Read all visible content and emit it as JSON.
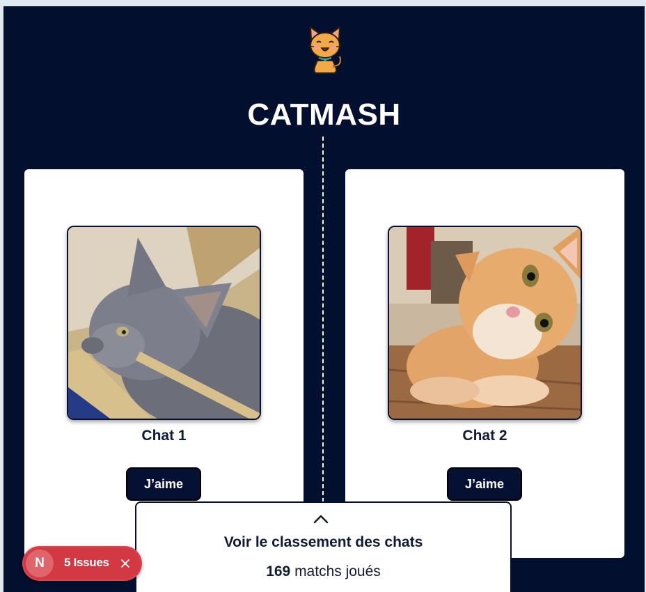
{
  "app": {
    "title": "CATMASH",
    "logo_icon": "cat-logo-icon"
  },
  "cats": [
    {
      "name": "Chat 1",
      "like_label": "J’aime",
      "image": "grey kitten in a cardboard box"
    },
    {
      "name": "Chat 2",
      "like_label": "J’aime",
      "image": "orange tabby cat tilting head"
    }
  ],
  "ranking": {
    "toggle_icon": "chevron-up-icon",
    "label": "Voir le classement des chats",
    "matches_count": "169",
    "matches_suffix": " matchs joués"
  },
  "dev_overlay": {
    "badge": "N",
    "issues_label": "5 Issues",
    "close_icon": "close-icon"
  },
  "colors": {
    "background": "#030f2e",
    "card": "#ffffff",
    "button": "#061032",
    "issues": "#d23943"
  }
}
